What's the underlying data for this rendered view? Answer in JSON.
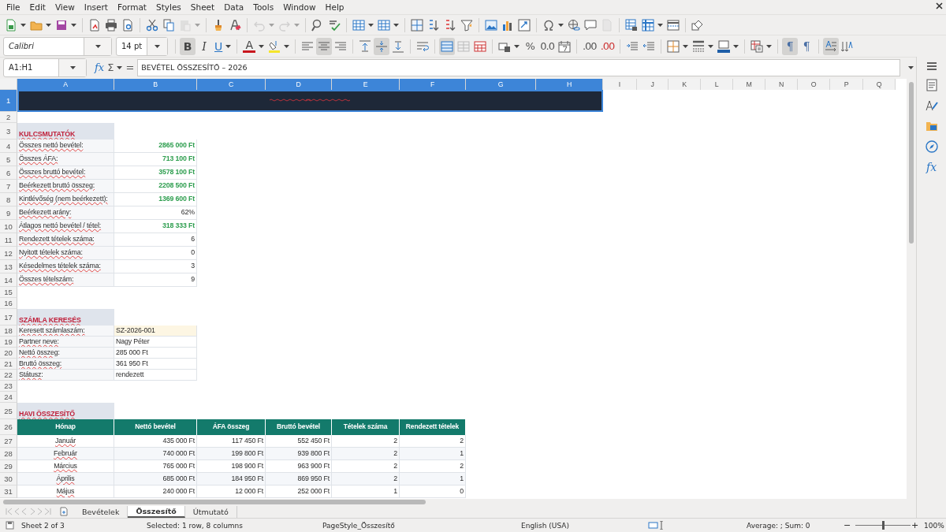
{
  "menu": [
    "File",
    "Edit",
    "View",
    "Insert",
    "Format",
    "Styles",
    "Sheet",
    "Data",
    "Tools",
    "Window",
    "Help"
  ],
  "standard_toolbar": [
    {
      "kind": "new",
      "dropdown": true,
      "disabled": false
    },
    {
      "kind": "open",
      "dropdown": true,
      "disabled": false
    },
    {
      "kind": "save",
      "dropdown": true,
      "disabled": false
    },
    {
      "kind": "separator"
    },
    {
      "kind": "pdf",
      "dropdown": false,
      "disabled": false
    },
    {
      "kind": "print",
      "dropdown": false,
      "disabled": false
    },
    {
      "kind": "preview",
      "dropdown": false,
      "disabled": false
    },
    {
      "kind": "separator"
    },
    {
      "kind": "cut",
      "dropdown": false,
      "disabled": false
    },
    {
      "kind": "copy",
      "dropdown": false,
      "disabled": false
    },
    {
      "kind": "paste",
      "dropdown": true,
      "disabled": true
    },
    {
      "kind": "separator"
    },
    {
      "kind": "clone",
      "dropdown": false,
      "disabled": false
    },
    {
      "kind": "clear",
      "dropdown": false,
      "disabled": false
    },
    {
      "kind": "separator"
    },
    {
      "kind": "undo",
      "dropdown": true,
      "disabled": true
    },
    {
      "kind": "redo",
      "dropdown": true,
      "disabled": true
    },
    {
      "kind": "separator"
    },
    {
      "kind": "find",
      "dropdown": false,
      "disabled": false
    },
    {
      "kind": "spelling",
      "dropdown": false,
      "disabled": false
    },
    {
      "kind": "separator"
    },
    {
      "kind": "rows",
      "dropdown": true,
      "disabled": false
    },
    {
      "kind": "columns",
      "dropdown": true,
      "disabled": false
    },
    {
      "kind": "separator"
    },
    {
      "kind": "sort",
      "dropdown": false,
      "disabled": false
    },
    {
      "kind": "sort_asc",
      "dropdown": false,
      "disabled": false
    },
    {
      "kind": "sort_desc",
      "dropdown": false,
      "disabled": false
    },
    {
      "kind": "filter",
      "dropdown": false,
      "disabled": false
    },
    {
      "kind": "separator"
    },
    {
      "kind": "image",
      "dropdown": false,
      "disabled": false
    },
    {
      "kind": "chart",
      "dropdown": false,
      "disabled": false
    },
    {
      "kind": "pivot",
      "dropdown": false,
      "disabled": false
    },
    {
      "kind": "separator"
    },
    {
      "kind": "special",
      "dropdown": true,
      "disabled": false
    },
    {
      "kind": "hyperlink",
      "dropdown": false,
      "disabled": false
    },
    {
      "kind": "comment",
      "dropdown": false,
      "disabled": false
    },
    {
      "kind": "header",
      "dropdown": false,
      "disabled": true
    },
    {
      "kind": "separator"
    },
    {
      "kind": "define_print",
      "dropdown": false,
      "disabled": false
    },
    {
      "kind": "freeze",
      "dropdown": true,
      "disabled": false
    },
    {
      "kind": "split",
      "dropdown": false,
      "disabled": false
    },
    {
      "kind": "separator"
    },
    {
      "kind": "shapes",
      "dropdown": false,
      "disabled": false
    }
  ],
  "font_name": "Calibri",
  "font_size": "14 pt",
  "format_toolbar": [
    {
      "kind": "bold",
      "glyph": "B",
      "on": true,
      "dropdown": false
    },
    {
      "kind": "italic",
      "glyph": "I",
      "on": false,
      "dropdown": false
    },
    {
      "kind": "underline",
      "glyph": "U",
      "on": false,
      "dropdown": true
    },
    {
      "kind": "separator"
    },
    {
      "kind": "font_color",
      "glyph": "A",
      "on": false,
      "dropdown": true
    },
    {
      "kind": "highlight",
      "on": false,
      "dropdown": true
    },
    {
      "kind": "separator"
    },
    {
      "kind": "align_left",
      "on": false,
      "dropdown": false
    },
    {
      "kind": "align_center",
      "on": true,
      "dropdown": false
    },
    {
      "kind": "align_right",
      "on": false,
      "dropdown": false
    },
    {
      "kind": "separator"
    },
    {
      "kind": "valign_top",
      "on": false,
      "dropdown": false
    },
    {
      "kind": "valign_center",
      "on": true,
      "dropdown": false
    },
    {
      "kind": "valign_bottom",
      "on": false,
      "dropdown": false
    },
    {
      "kind": "separator"
    },
    {
      "kind": "wrap",
      "on": false,
      "dropdown": false
    },
    {
      "kind": "separator"
    },
    {
      "kind": "merge_center",
      "on": true,
      "dropdown": false
    },
    {
      "kind": "merge",
      "on": false,
      "dropdown": false
    },
    {
      "kind": "unmerge",
      "on": false,
      "dropdown": false
    },
    {
      "kind": "separator"
    },
    {
      "kind": "currency",
      "on": false,
      "dropdown": true
    },
    {
      "kind": "percent",
      "glyph": "%",
      "on": false,
      "dropdown": false
    },
    {
      "kind": "number",
      "glyph": "0.0",
      "on": false,
      "dropdown": false
    },
    {
      "kind": "date",
      "on": false,
      "dropdown": false
    },
    {
      "kind": "separator"
    },
    {
      "kind": "add_decimal",
      "glyph": ".00",
      "on": false,
      "dropdown": false
    },
    {
      "kind": "delete_decimal",
      "glyph": ".00",
      "on": false,
      "dropdown": false
    },
    {
      "kind": "separator"
    },
    {
      "kind": "indent",
      "on": false,
      "dropdown": false
    },
    {
      "kind": "outdent",
      "on": false,
      "dropdown": false
    },
    {
      "kind": "separator"
    },
    {
      "kind": "borders",
      "on": false,
      "dropdown": true
    },
    {
      "kind": "border_style",
      "on": false,
      "dropdown": true
    },
    {
      "kind": "border_color",
      "on": false,
      "dropdown": true
    },
    {
      "kind": "separator"
    },
    {
      "kind": "conditional",
      "on": false,
      "dropdown": true
    },
    {
      "kind": "separator"
    },
    {
      "kind": "ltr",
      "glyph": "¶",
      "on": true,
      "dropdown": false
    },
    {
      "kind": "rtl",
      "glyph": "¶",
      "on": false,
      "dropdown": false
    },
    {
      "kind": "separator"
    },
    {
      "kind": "text_ltr",
      "on": true,
      "dropdown": false
    },
    {
      "kind": "text_ttb",
      "on": false,
      "dropdown": false
    }
  ],
  "formula_bar": {
    "name_box": "A1:H1",
    "function_glyph": "fx",
    "sum_glyph": "Σ",
    "equals_glyph": "=",
    "content": "BEVÉTEL ÖSSZESÍTŐ – 2026"
  },
  "columns": [
    {
      "label": "A",
      "selected": true
    },
    {
      "label": "B",
      "selected": true
    },
    {
      "label": "C",
      "selected": true
    },
    {
      "label": "D",
      "selected": true
    },
    {
      "label": "E",
      "selected": true
    },
    {
      "label": "F",
      "selected": true
    },
    {
      "label": "G",
      "selected": true
    },
    {
      "label": "H",
      "selected": true
    },
    {
      "label": "I",
      "selected": false
    },
    {
      "label": "J",
      "selected": false
    },
    {
      "label": "K",
      "selected": false
    },
    {
      "label": "L",
      "selected": false
    },
    {
      "label": "M",
      "selected": false
    },
    {
      "label": "N",
      "selected": false
    },
    {
      "label": "O",
      "selected": false
    },
    {
      "label": "P",
      "selected": false
    },
    {
      "label": "Q",
      "selected": false
    }
  ],
  "rows": [
    {
      "number": "1",
      "kind": "title",
      "selected": true
    },
    {
      "number": "2",
      "kind": "blank",
      "selected": false
    },
    {
      "number": "3",
      "kind": "section",
      "selected": false,
      "cells": [
        "KULCSMUTATÓK"
      ]
    },
    {
      "number": "4",
      "kind": "kpi",
      "selected": false,
      "emphasis": true,
      "cells": [
        "Összes nettó bevétel:",
        "2865 000 Ft"
      ]
    },
    {
      "number": "5",
      "kind": "kpi",
      "selected": false,
      "emphasis": true,
      "cells": [
        "Összes ÁFA:",
        "713 100 Ft"
      ]
    },
    {
      "number": "6",
      "kind": "kpi",
      "selected": false,
      "emphasis": true,
      "cells": [
        "Összes bruttó bevétel:",
        "3578 100 Ft"
      ]
    },
    {
      "number": "7",
      "kind": "kpi",
      "selected": false,
      "emphasis": true,
      "cells": [
        "Beérkezett bruttó összeg:",
        "2208 500 Ft"
      ]
    },
    {
      "number": "8",
      "kind": "kpi",
      "selected": false,
      "emphasis": true,
      "cells": [
        "Kintlévőség (nem beérkezett):",
        "1369 600 Ft"
      ]
    },
    {
      "number": "9",
      "kind": "kpi",
      "selected": false,
      "emphasis": false,
      "cells": [
        "Beérkezett arány:",
        "62%"
      ]
    },
    {
      "number": "10",
      "kind": "kpi",
      "selected": false,
      "emphasis": true,
      "cells": [
        "Átlagos nettó bevétel / tétel:",
        "318 333 Ft"
      ]
    },
    {
      "number": "11",
      "kind": "kpi",
      "selected": false,
      "emphasis": false,
      "cells": [
        "Rendezett tételek száma:",
        "6"
      ]
    },
    {
      "number": "12",
      "kind": "kpi",
      "selected": false,
      "emphasis": false,
      "cells": [
        "Nyitott tételek száma:",
        "0"
      ]
    },
    {
      "number": "13",
      "kind": "kpi",
      "selected": false,
      "emphasis": false,
      "cells": [
        "Késedelmes tételek száma:",
        "3"
      ]
    },
    {
      "number": "14",
      "kind": "kpi",
      "selected": false,
      "emphasis": false,
      "cells": [
        "Összes tételszám:",
        "9"
      ]
    },
    {
      "number": "15",
      "kind": "blank",
      "selected": false
    },
    {
      "number": "16",
      "kind": "blank",
      "selected": false
    },
    {
      "number": "17",
      "kind": "section",
      "selected": false,
      "cells": [
        "SZÁMLA KERESÉS"
      ]
    },
    {
      "number": "18",
      "kind": "lookup",
      "selected": false,
      "input": true,
      "cells": [
        "Keresett számlaszám:",
        "SZ-2026-001"
      ]
    },
    {
      "number": "19",
      "kind": "lookup",
      "selected": false,
      "input": false,
      "cells": [
        "Partner neve:",
        "Nagy Péter"
      ]
    },
    {
      "number": "20",
      "kind": "lookup",
      "selected": false,
      "input": false,
      "cells": [
        "Nettó összeg:",
        "285 000 Ft"
      ]
    },
    {
      "number": "21",
      "kind": "lookup",
      "selected": false,
      "input": false,
      "cells": [
        "Bruttó összeg:",
        "361 950 Ft"
      ]
    },
    {
      "number": "22",
      "kind": "lookup",
      "selected": false,
      "input": false,
      "cells": [
        "Státusz:",
        "rendezett"
      ]
    },
    {
      "number": "23",
      "kind": "blank",
      "selected": false
    },
    {
      "number": "24",
      "kind": "blank",
      "selected": false
    },
    {
      "number": "25",
      "kind": "section",
      "selected": false,
      "cells": [
        "HAVI ÖSSZESÍTŐ"
      ]
    },
    {
      "number": "26",
      "kind": "table_header",
      "selected": false,
      "cells": [
        "Hónap",
        "Nettó bevétel",
        "ÁFA összeg",
        "Bruttó bevétel",
        "Tételek száma",
        "Rendezett tételek"
      ]
    },
    {
      "number": "27",
      "kind": "table_row",
      "selected": false,
      "cells": [
        "Január",
        "435 000 Ft",
        "117 450 Ft",
        "552 450 Ft",
        "2",
        "2"
      ]
    },
    {
      "number": "28",
      "kind": "table_row",
      "selected": false,
      "cells": [
        "Február",
        "740 000 Ft",
        "199 800 Ft",
        "939 800 Ft",
        "2",
        "1"
      ]
    },
    {
      "number": "29",
      "kind": "table_row",
      "selected": false,
      "cells": [
        "Március",
        "765 000 Ft",
        "198 900 Ft",
        "963 900 Ft",
        "2",
        "2"
      ]
    },
    {
      "number": "30",
      "kind": "table_row",
      "selected": false,
      "cells": [
        "Április",
        "685 000 Ft",
        "184 950 Ft",
        "869 950 Ft",
        "2",
        "1"
      ]
    },
    {
      "number": "31",
      "kind": "table_row",
      "selected": false,
      "cells": [
        "Május",
        "240 000 Ft",
        "12 000 Ft",
        "252 000 Ft",
        "1",
        "0"
      ]
    }
  ],
  "sheet_tabs": [
    {
      "label": "Bevételek",
      "selected": false
    },
    {
      "label": "Összesítő",
      "selected": true
    },
    {
      "label": "Útmutató",
      "selected": false
    }
  ],
  "sidebar": {
    "functions_glyph": "fx"
  },
  "status_bar": {
    "sheet": "Sheet 2 of 3",
    "selection": "Selected: 1 row, 8 columns",
    "page_style": "PageStyle_Összesítő",
    "language": "English (USA)",
    "summary": "Average: ; Sum: 0",
    "zoom_minus": "−",
    "zoom_plus": "+",
    "zoom": {
      "level": 0.5
    },
    "zoom_reading": "100%"
  }
}
